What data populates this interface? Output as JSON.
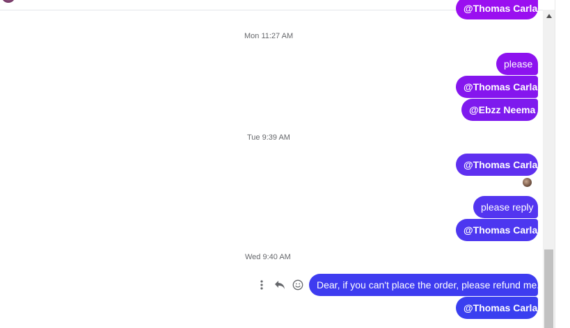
{
  "timestamps": {
    "mon": "Mon 11:27 AM",
    "tue": "Tue 9:39 AM",
    "wed": "Wed 9:40 AM"
  },
  "messages": {
    "m0": "@Thomas Carla",
    "m1": "please",
    "m2": "@Thomas Carla",
    "m3": "@Ebzz Neema",
    "m4": "@Thomas Carla",
    "m5": "please reply",
    "m6": "@Thomas Carla",
    "m7": "Dear, if you can't place the order, please refund me.",
    "m8": "@Thomas Carla"
  },
  "colors": {
    "purple_top": "#9a0ff0",
    "purple": "#8a14ee",
    "violet": "#6c2cf0",
    "indigo": "#4e3af0",
    "blue": "#3a3ff0",
    "timestamp_text": "#65676b"
  },
  "icons": {
    "more": "more-options-icon",
    "reply": "reply-icon",
    "react": "smiley-react-icon",
    "scroll_up": "scroll-up-arrow-icon"
  }
}
